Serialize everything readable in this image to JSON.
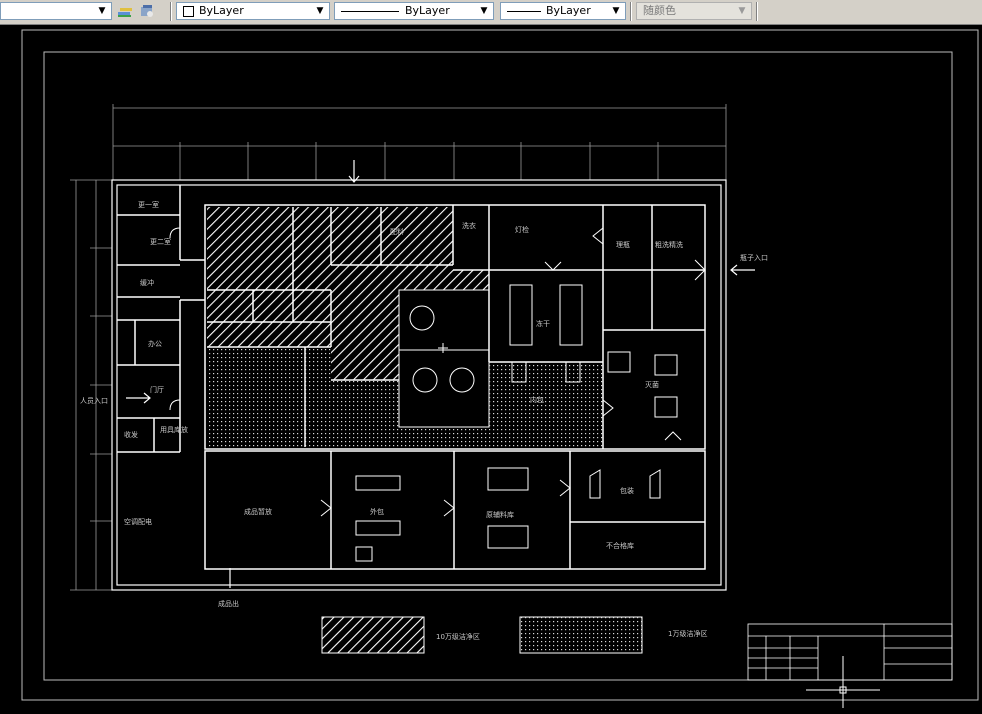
{
  "toolbar": {
    "layer_dropdown_value": "",
    "color_dropdown_value": "ByLayer",
    "linetype_dropdown_value": "ByLayer",
    "lineweight_dropdown_value": "ByLayer",
    "plotstyle_dropdown_value": "随颜色",
    "icons": [
      "layer-previous-icon",
      "layer-states-icon"
    ]
  },
  "drawing": {
    "rooms": {
      "r01": "更一室",
      "r02": "更二室",
      "r03": "缓冲",
      "r04": "办公",
      "r05": "门厅",
      "r06": "收发",
      "r07": "用具库放",
      "r08": "人员入口",
      "r09": "空调配电",
      "r10": "成品暂放",
      "r11": "外包",
      "r12": "原辅料库",
      "r13": "不合格库",
      "r14": "包装",
      "r15": "成品出",
      "r16": "理瓶",
      "r17": "粗洗精洗",
      "r18": "瓶子入口",
      "r19": "洗衣",
      "r20": "灭菌",
      "r21": "灯检",
      "r22": "冻干",
      "r23": "内包",
      "r24": "配料"
    },
    "legend": {
      "hatched_label": "10万级洁净区",
      "dotted_label": "1万级洁净区"
    }
  },
  "colors": {
    "background": "#000000",
    "lines": "#ffffff",
    "toolbar": "#d4d0c8"
  }
}
